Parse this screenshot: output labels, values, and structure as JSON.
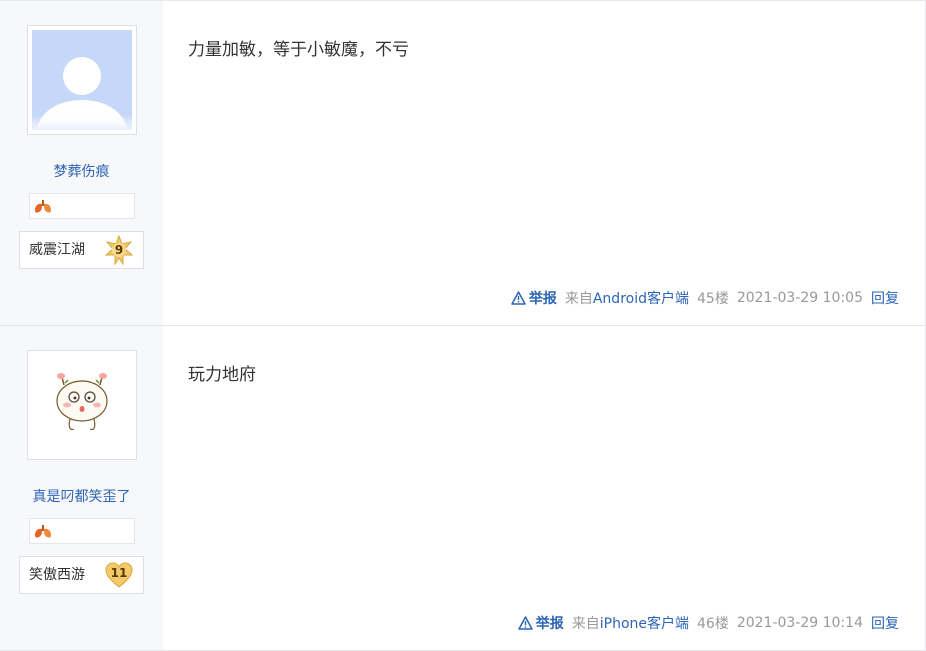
{
  "posts": [
    {
      "username": "梦葬伤痕",
      "level_name": "威震江湖",
      "level": "9",
      "text": "力量加敏，等于小敏魔，不亏",
      "report_label": "举报",
      "client_prefix": "来自",
      "client_device": "Android客户端",
      "floor": "45楼",
      "timestamp": "2021-03-29 10:05",
      "reply_label": "回复"
    },
    {
      "username": "真是叼都笑歪了",
      "level_name": "笑傲西游",
      "level": "11",
      "text": "玩力地府",
      "report_label": "举报",
      "client_prefix": "来自",
      "client_device": "iPhone客户端",
      "floor": "46楼",
      "timestamp": "2021-03-29 10:14",
      "reply_label": "回复"
    }
  ],
  "colors": {
    "link": "#2d64b3",
    "meta": "#999999",
    "sidebar_bg": "#f7f8fa",
    "avatar_default_bg": "#c5d8f8",
    "level_badge_gold": "#f3c96a"
  },
  "icons": {
    "report": "warning-triangle-icon",
    "member_badge": "lungs-icon"
  }
}
